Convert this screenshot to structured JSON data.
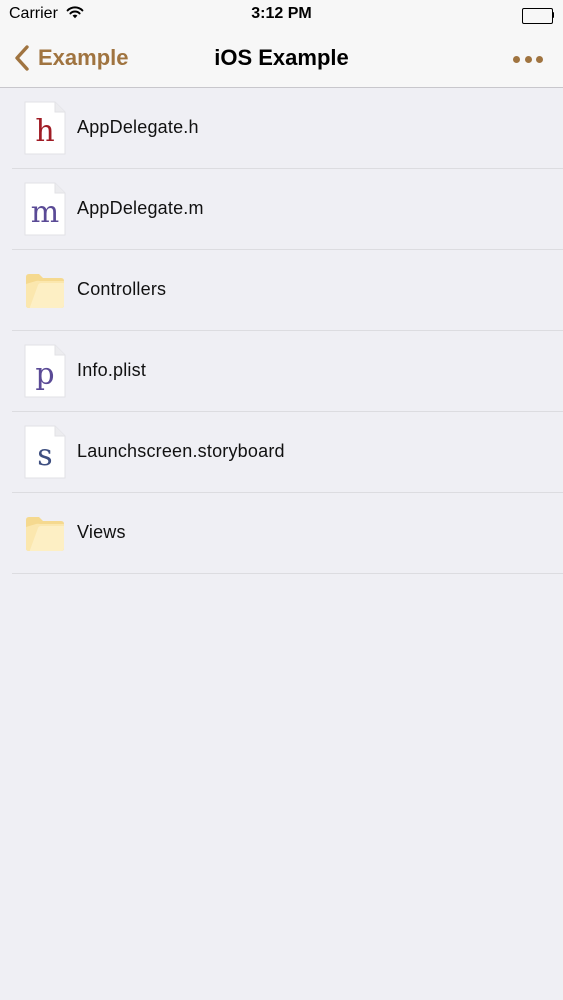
{
  "status_bar": {
    "carrier": "Carrier",
    "time": "3:12 PM"
  },
  "nav_bar": {
    "back_label": "Example",
    "title": "iOS Example",
    "more_icon": "ellipsis-icon",
    "accent_color": "#a07440"
  },
  "files": [
    {
      "name": "AppDelegate.h",
      "type": "file",
      "letter": "h",
      "letter_color": "#a01c25",
      "icon": "header-file-icon"
    },
    {
      "name": "AppDelegate.m",
      "type": "file",
      "letter": "m",
      "letter_color": "#5a4a96",
      "icon": "source-file-icon"
    },
    {
      "name": "Controllers",
      "type": "folder",
      "icon": "folder-icon"
    },
    {
      "name": "Info.plist",
      "type": "file",
      "letter": "p",
      "letter_color": "#5a4a96",
      "icon": "plist-file-icon"
    },
    {
      "name": "Launchscreen.storyboard",
      "type": "file",
      "letter": "s",
      "letter_color": "#3e4f80",
      "icon": "storyboard-file-icon"
    },
    {
      "name": "Views",
      "type": "folder",
      "icon": "folder-icon"
    }
  ]
}
